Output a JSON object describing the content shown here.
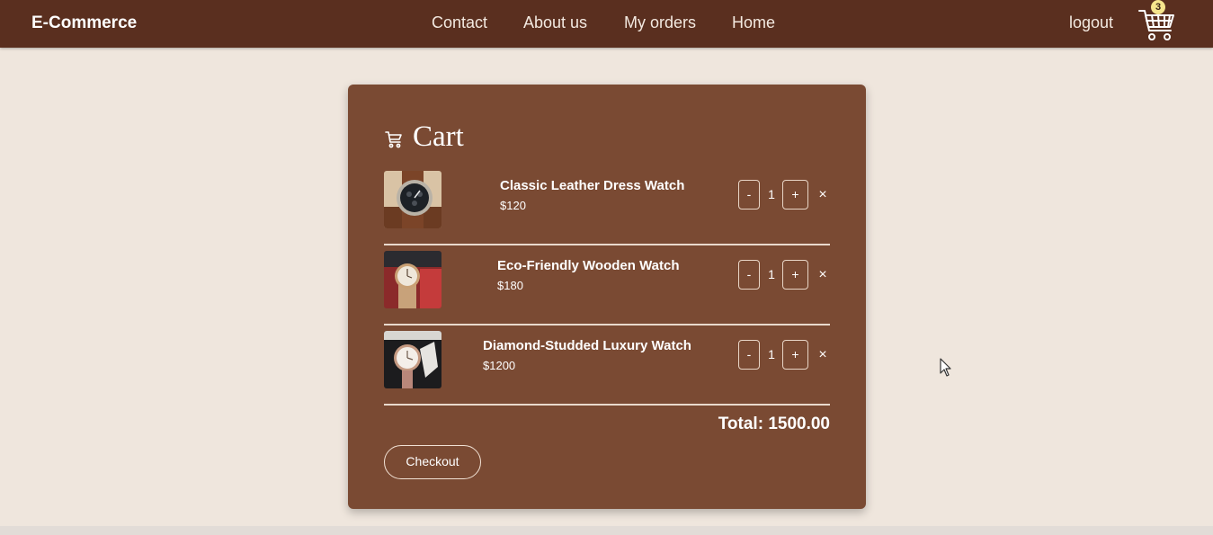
{
  "navbar": {
    "brand": "E-Commerce",
    "links": [
      "Contact",
      "About us",
      "My orders",
      "Home"
    ],
    "logout": "logout",
    "cart_count": "3"
  },
  "cart": {
    "title": "Cart",
    "items": [
      {
        "name": "Classic Leather Dress Watch",
        "price": "$120",
        "qty": "1",
        "minus": "-",
        "plus": "+",
        "remove": "×"
      },
      {
        "name": "Eco-Friendly Wooden Watch",
        "price": "$180",
        "qty": "1",
        "minus": "-",
        "plus": "+",
        "remove": "×"
      },
      {
        "name": "Diamond-Studded Luxury Watch",
        "price": "$1200",
        "qty": "1",
        "minus": "-",
        "plus": "+",
        "remove": "×"
      }
    ],
    "total": "Total: 1500.00",
    "checkout": "Checkout"
  },
  "colors": {
    "navbar_bg": "#5a2f1f",
    "page_bg": "#efe6dd",
    "card_bg": "#7a4a33",
    "text": "#ffffff"
  },
  "icons": {
    "cart_nav": "shopping-cart-icon",
    "cart_title": "cart-icon",
    "remove": "close-icon"
  }
}
